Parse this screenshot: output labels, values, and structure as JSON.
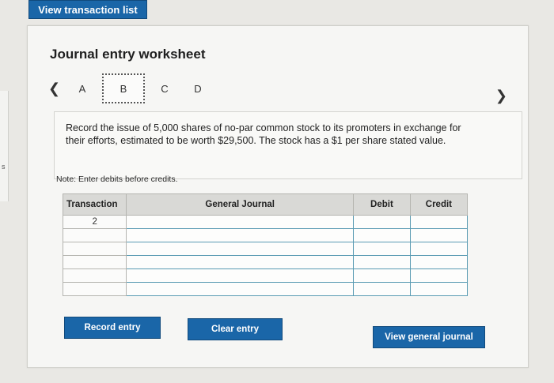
{
  "top": {
    "view_transaction_list": "View transaction list"
  },
  "left_stub": {
    "letter": "s"
  },
  "worksheet": {
    "title": "Journal entry worksheet",
    "tabs": [
      "A",
      "B",
      "C",
      "D"
    ],
    "active_tab": "B",
    "prompt": "Record the issue of 5,000 shares of no-par common stock to its promoters in exchange for their efforts, estimated to be worth $29,500. The stock has a $1 per share stated value.",
    "note": "Note: Enter debits before credits."
  },
  "journal_table": {
    "headers": {
      "transaction": "Transaction",
      "general_journal": "General Journal",
      "debit": "Debit",
      "credit": "Credit"
    },
    "transaction_number": "2",
    "rows": 6
  },
  "buttons": {
    "record_entry": "Record entry",
    "clear_entry": "Clear entry",
    "view_general_journal": "View general journal"
  },
  "colors": {
    "accent": "#1a66a8",
    "field_border": "#5a9bb3"
  }
}
